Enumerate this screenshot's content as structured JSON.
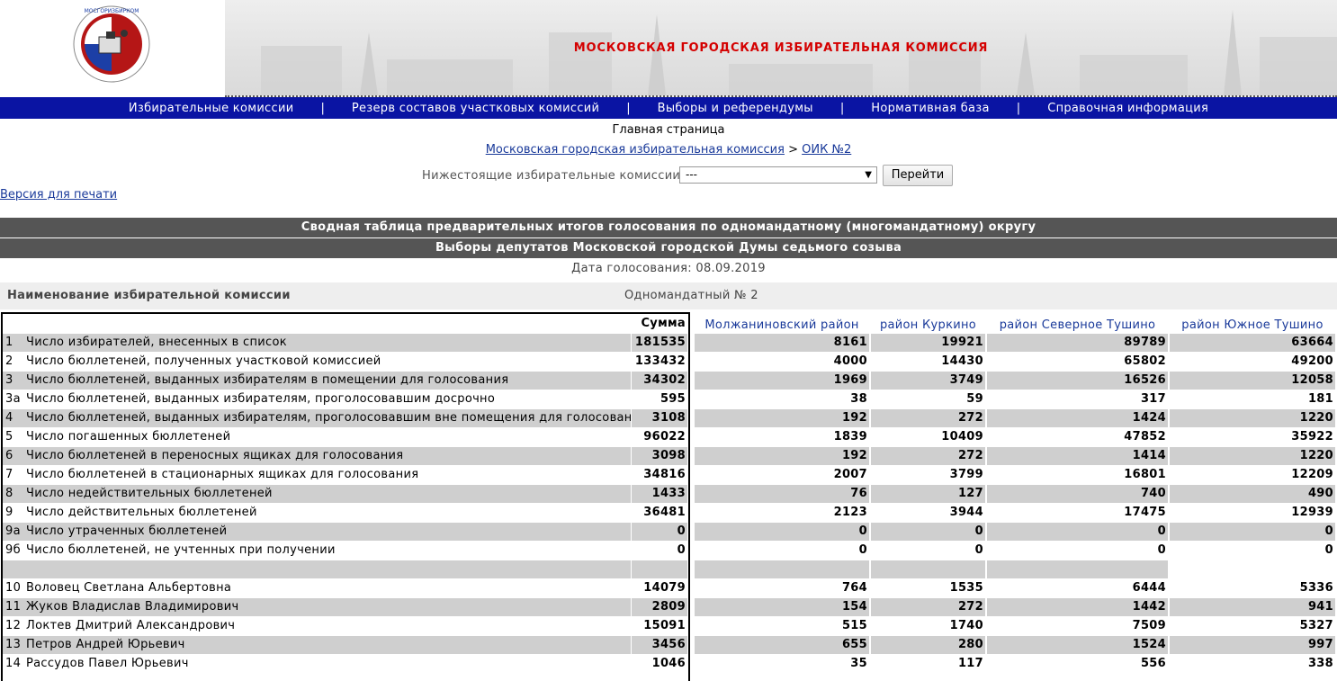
{
  "header": {
    "title": "МОСКОВСКАЯ ГОРОДСКАЯ ИЗБИРАТЕЛЬНАЯ КОМИССИЯ",
    "accent_color": "#d40000"
  },
  "nav": {
    "items": [
      {
        "label": "Избирательные комиссии"
      },
      {
        "label": "Резерв составов участковых комиссий"
      },
      {
        "label": "Выборы и референдумы"
      },
      {
        "label": "Нормативная база"
      },
      {
        "label": "Справочная информация"
      }
    ],
    "separator": "|",
    "bg_color": "#0a14a3"
  },
  "breadcrumb": {
    "home": "Главная страница",
    "parent": "Московская городская избирательная комиссия",
    "arrow": ">",
    "current": "ОИК №2"
  },
  "subcommissions": {
    "label": "Нижестоящие избирательные комиссии:",
    "selected": "---",
    "button": "Перейти"
  },
  "print_link": "Версия для печати",
  "report": {
    "title": "Сводная таблица предварительных итогов голосования по одномандатному (многомандатному) округу",
    "subtitle": "Выборы депутатов Московской городской Думы седьмого созыва",
    "date_label": "Дата голосования:",
    "date": "08.09.2019",
    "commission_label": "Наименование избирательной комиссии",
    "commission_value": "Одномандатный № 2"
  },
  "table": {
    "sum_header": "Сумма",
    "districts": [
      "Молжаниновский район",
      "район Куркино",
      "район Северное Тушино",
      "район Южное Тушино"
    ],
    "rows": [
      {
        "num": "1",
        "name": "Число избирателей, внесенных в список",
        "sum": "181535",
        "d": [
          "8161",
          "19921",
          "89789",
          "63664"
        ]
      },
      {
        "num": "2",
        "name": "Число бюллетеней, полученных участковой комиссией",
        "sum": "133432",
        "d": [
          "4000",
          "14430",
          "65802",
          "49200"
        ]
      },
      {
        "num": "3",
        "name": "Число бюллетеней, выданных избирателям в помещении для голосования",
        "sum": "34302",
        "d": [
          "1969",
          "3749",
          "16526",
          "12058"
        ]
      },
      {
        "num": "3а",
        "name": "Число бюллетеней, выданных избирателям, проголосовавшим досрочно",
        "sum": "595",
        "d": [
          "38",
          "59",
          "317",
          "181"
        ]
      },
      {
        "num": "4",
        "name": "Число бюллетеней, выданных избирателям, проголосовавшим вне помещения для голосования",
        "sum": "3108",
        "d": [
          "192",
          "272",
          "1424",
          "1220"
        ]
      },
      {
        "num": "5",
        "name": "Число погашенных бюллетеней",
        "sum": "96022",
        "d": [
          "1839",
          "10409",
          "47852",
          "35922"
        ]
      },
      {
        "num": "6",
        "name": "Число бюллетеней в переносных ящиках для голосования",
        "sum": "3098",
        "d": [
          "192",
          "272",
          "1414",
          "1220"
        ]
      },
      {
        "num": "7",
        "name": "Число бюллетеней в стационарных ящиках для голосования",
        "sum": "34816",
        "d": [
          "2007",
          "3799",
          "16801",
          "12209"
        ]
      },
      {
        "num": "8",
        "name": "Число недействительных бюллетеней",
        "sum": "1433",
        "d": [
          "76",
          "127",
          "740",
          "490"
        ]
      },
      {
        "num": "9",
        "name": "Число действительных бюллетеней",
        "sum": "36481",
        "d": [
          "2123",
          "3944",
          "17475",
          "12939"
        ]
      },
      {
        "num": "9а",
        "name": "Число утраченных бюллетеней",
        "sum": "0",
        "d": [
          "0",
          "0",
          "0",
          "0"
        ]
      },
      {
        "num": "9б",
        "name": "Число бюллетеней, не учтенных при получении",
        "sum": "0",
        "d": [
          "0",
          "0",
          "0",
          "0"
        ]
      },
      {
        "num": "",
        "name": "",
        "sum": "",
        "d": [
          "",
          "",
          "",
          ""
        ]
      },
      {
        "num": "10",
        "name": "Воловец Светлана Альбертовна",
        "sum": "14079",
        "d": [
          "764",
          "1535",
          "6444",
          "5336"
        ]
      },
      {
        "num": "11",
        "name": "Жуков Владислав Владимирович",
        "sum": "2809",
        "d": [
          "154",
          "272",
          "1442",
          "941"
        ]
      },
      {
        "num": "12",
        "name": "Локтев Дмитрий Александрович",
        "sum": "15091",
        "d": [
          "515",
          "1740",
          "7509",
          "5327"
        ]
      },
      {
        "num": "13",
        "name": "Петров Андрей Юрьевич",
        "sum": "3456",
        "d": [
          "655",
          "280",
          "1524",
          "997"
        ]
      },
      {
        "num": "14",
        "name": "Рассудов Павел Юрьевич",
        "sum": "1046",
        "d": [
          "35",
          "117",
          "556",
          "338"
        ]
      }
    ]
  }
}
